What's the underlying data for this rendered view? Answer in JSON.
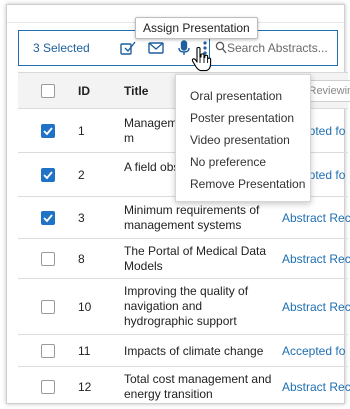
{
  "toolbar": {
    "selected_label": "3 Selected",
    "icons": [
      "check-icon",
      "mail-icon",
      "mic-icon",
      "more-icon"
    ],
    "search_placeholder": "Search Abstracts..."
  },
  "tooltip": {
    "text": "Assign Presentation"
  },
  "menu": {
    "items": [
      {
        "label": "Oral presentation"
      },
      {
        "label": "Poster presentation"
      },
      {
        "label": "Video presentation"
      },
      {
        "label": "No preference"
      },
      {
        "label": "Remove Presentation"
      }
    ]
  },
  "table": {
    "headers": {
      "id": "ID",
      "title": "Title",
      "status_placeholder": "Filter Reviewing Status"
    },
    "rows": [
      {
        "checked": true,
        "id": "1",
        "title": "Management of a person's m",
        "status": "Accepted fo"
      },
      {
        "checked": true,
        "id": "2",
        "title": "A field obs interaction",
        "status": "Accepted fo"
      },
      {
        "checked": true,
        "id": "3",
        "title": "Minimum requirements of management systems",
        "status": "Abstract Rec"
      },
      {
        "checked": false,
        "id": "8",
        "title": "The Portal of Medical Data Models",
        "status": "Abstract Rec"
      },
      {
        "checked": false,
        "id": "10",
        "title": "Improving the quality of navigation and hydrographic support",
        "status": "Abstract Rec"
      },
      {
        "checked": false,
        "id": "11",
        "title": "Impacts of climate change",
        "status": "Accepted fo"
      },
      {
        "checked": false,
        "id": "12",
        "title": "Total cost management and energy transition",
        "status": "Abstract Rec"
      }
    ]
  },
  "colors": {
    "accent": "#1f6fb2",
    "checkbox": "#1f72c6"
  }
}
